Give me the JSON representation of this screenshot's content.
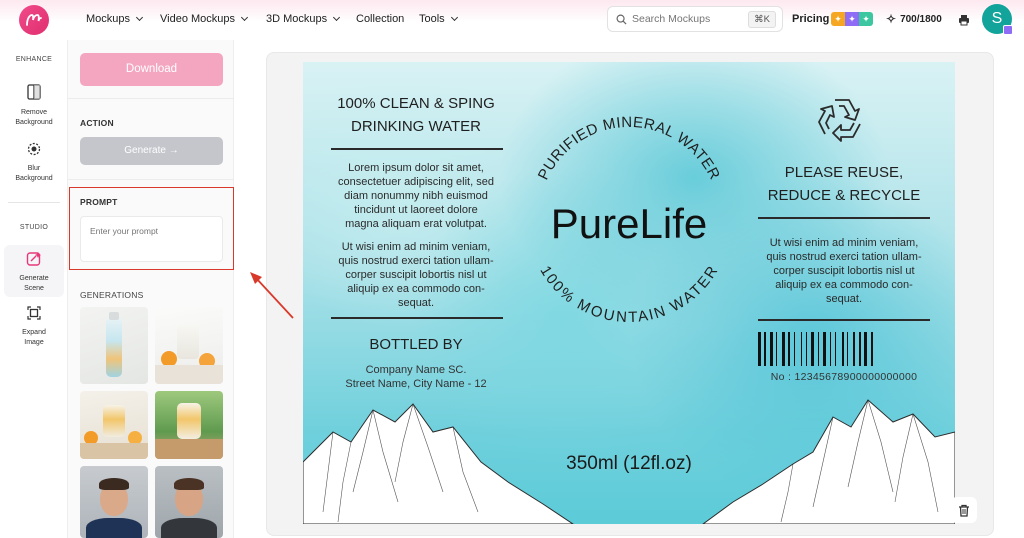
{
  "nav": {
    "items": [
      {
        "label": "Mockups"
      },
      {
        "label": "Video Mockups"
      },
      {
        "label": "3D Mockups"
      },
      {
        "label": "Collection"
      },
      {
        "label": "Tools"
      }
    ],
    "search_placeholder": "Search Mockups",
    "search_shortcut": "⌘K",
    "pricing_label": "Pricing",
    "credits": "700/1800",
    "avatar_letter": "S"
  },
  "rail": {
    "enhance_heading": "ENHANCE",
    "remove_bg": "Remove Background",
    "blur_bg": "Blur Background",
    "studio_heading": "STUDIO",
    "generate_scene": "Generate Scene",
    "expand_image": "Expand Image"
  },
  "panel": {
    "download_label": "Download",
    "action_heading": "ACTION",
    "generate_label": "Generate →",
    "prompt_heading": "PROMPT",
    "prompt_placeholder": "Enter your prompt",
    "generations_heading": "GENERATIONS"
  },
  "label": {
    "left_title_1": "100% CLEAN & SPING",
    "left_title_2": "DRINKING WATER",
    "left_para_1": [
      "Lorem ipsum dolor sit amet,",
      "consectetuer adipiscing elit, sed",
      "diam nonummy nibh euismod",
      "tincidunt ut laoreet dolore",
      "magna aliquam erat volutpat."
    ],
    "left_para_2": [
      "Ut wisi enim ad minim veniam,",
      "quis nostrud exerci tation ullam-",
      "corper suscipit lobortis nisl ut",
      "aliquip ex ea commodo con-",
      "sequat."
    ],
    "bottled_by": "BOTTLED BY",
    "company": "Company Name SC.",
    "address": "Street Name, City Name - 12",
    "arc_top": "PURIFIED MINERAL WATER",
    "brand": "PureLife",
    "arc_bottom": "100% MOUNTAIN WATER",
    "volume": "350ml (12fl.oz)",
    "right_title_1": "PLEASE REUSE,",
    "right_title_2": "REDUCE & RECYCLE",
    "right_para": [
      "Ut wisi enim ad minim veniam,",
      "quis nostrud exerci tation ullam-",
      "corper suscipit lobortis nisl ut",
      "aliquip ex ea commodo con-",
      "sequat."
    ],
    "barcode_number": "No : 12345678900000000000"
  },
  "colors": {
    "brand_pink": "#e8367a",
    "download_btn": "#f4a6c0",
    "generate_btn": "#c4c6cc",
    "highlight_red": "#d9392b",
    "avatar_teal": "#12a39a"
  }
}
